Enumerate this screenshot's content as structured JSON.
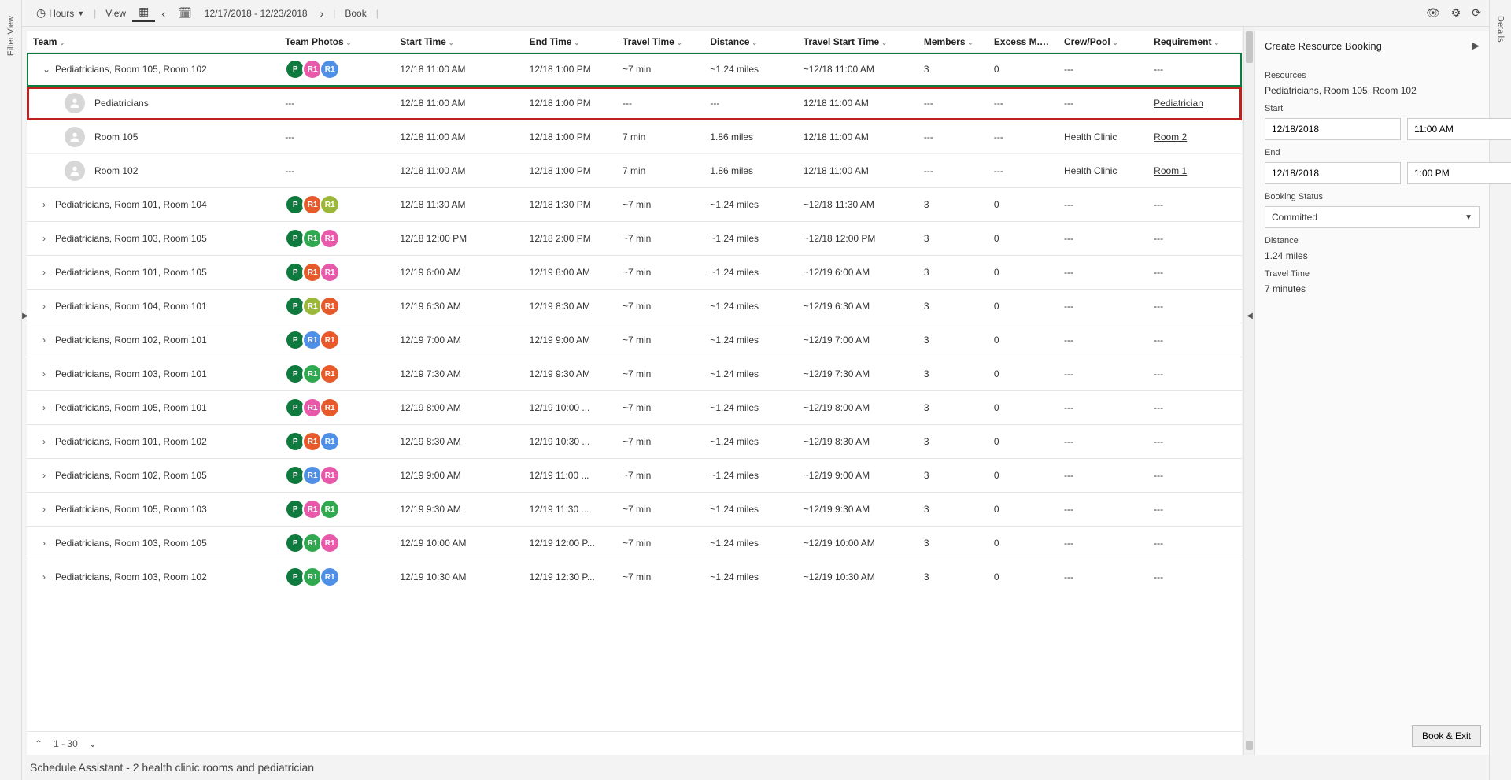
{
  "leftTab": {
    "label": "Filter View"
  },
  "rightTab": {
    "label": "Details"
  },
  "toolbar": {
    "hours": "Hours",
    "view": "View",
    "dateRange": "12/17/2018 - 12/23/2018",
    "book": "Book"
  },
  "columns": {
    "team": "Team",
    "photos": "Team Photos",
    "start": "Start Time",
    "end": "End Time",
    "travel": "Travel Time",
    "dist": "Distance",
    "tstart": "Travel Start Time",
    "members": "Members",
    "excess": "Excess M...",
    "crew": "Crew/Pool",
    "req": "Requirement"
  },
  "colors": {
    "pGreen": "#0f7a3d",
    "orange": "#e65a2c",
    "pink": "#e85aa9",
    "blue": "#4f8fe6",
    "olive": "#9bb83a",
    "green": "#2fa84f",
    "dgreen": "#1f8a3a"
  },
  "rows": [
    {
      "type": "parent",
      "expanded": true,
      "first": true,
      "team": "Pediatricians, Room 105, Room 102",
      "photos": [
        [
          "P",
          "pGreen"
        ],
        [
          "R1",
          "pink"
        ],
        [
          "R1",
          "blue"
        ]
      ],
      "start": "12/18 11:00 AM",
      "end": "12/18 1:00 PM",
      "travel": "~7 min",
      "dist": "~1.24 miles",
      "tstart": "~12/18 11:00 AM",
      "members": "3",
      "excess": "0",
      "crew": "---",
      "req": "---"
    },
    {
      "type": "child",
      "selected": true,
      "team": "Pediatricians",
      "photos": "---",
      "start": "12/18 11:00 AM",
      "end": "12/18 1:00 PM",
      "travel": "---",
      "dist": "---",
      "tstart": "12/18 11:00 AM",
      "members": "---",
      "excess": "---",
      "crew": "---",
      "req": "Pediatrician",
      "reqLink": true
    },
    {
      "type": "child",
      "team": "Room 105",
      "photos": "---",
      "start": "12/18 11:00 AM",
      "end": "12/18 1:00 PM",
      "travel": "7 min",
      "dist": "1.86 miles",
      "tstart": "12/18 11:00 AM",
      "members": "---",
      "excess": "---",
      "crew": "Health Clinic",
      "req": "Room 2",
      "reqLink": true
    },
    {
      "type": "child",
      "team": "Room 102",
      "photos": "---",
      "start": "12/18 11:00 AM",
      "end": "12/18 1:00 PM",
      "travel": "7 min",
      "dist": "1.86 miles",
      "tstart": "12/18 11:00 AM",
      "members": "---",
      "excess": "---",
      "crew": "Health Clinic",
      "req": "Room 1",
      "reqLink": true
    },
    {
      "type": "parent",
      "team": "Pediatricians, Room 101, Room 104",
      "photos": [
        [
          "P",
          "pGreen"
        ],
        [
          "R1",
          "orange"
        ],
        [
          "R1",
          "olive"
        ]
      ],
      "start": "12/18 11:30 AM",
      "end": "12/18 1:30 PM",
      "travel": "~7 min",
      "dist": "~1.24 miles",
      "tstart": "~12/18 11:30 AM",
      "members": "3",
      "excess": "0",
      "crew": "---",
      "req": "---"
    },
    {
      "type": "parent",
      "team": "Pediatricians, Room 103, Room 105",
      "photos": [
        [
          "P",
          "pGreen"
        ],
        [
          "R1",
          "green"
        ],
        [
          "R1",
          "pink"
        ]
      ],
      "start": "12/18 12:00 PM",
      "end": "12/18 2:00 PM",
      "travel": "~7 min",
      "dist": "~1.24 miles",
      "tstart": "~12/18 12:00 PM",
      "members": "3",
      "excess": "0",
      "crew": "---",
      "req": "---"
    },
    {
      "type": "parent",
      "team": "Pediatricians, Room 101, Room 105",
      "photos": [
        [
          "P",
          "pGreen"
        ],
        [
          "R1",
          "orange"
        ],
        [
          "R1",
          "pink"
        ]
      ],
      "start": "12/19 6:00 AM",
      "end": "12/19 8:00 AM",
      "travel": "~7 min",
      "dist": "~1.24 miles",
      "tstart": "~12/19 6:00 AM",
      "members": "3",
      "excess": "0",
      "crew": "---",
      "req": "---"
    },
    {
      "type": "parent",
      "team": "Pediatricians, Room 104, Room 101",
      "photos": [
        [
          "P",
          "pGreen"
        ],
        [
          "R1",
          "olive"
        ],
        [
          "R1",
          "orange"
        ]
      ],
      "start": "12/19 6:30 AM",
      "end": "12/19 8:30 AM",
      "travel": "~7 min",
      "dist": "~1.24 miles",
      "tstart": "~12/19 6:30 AM",
      "members": "3",
      "excess": "0",
      "crew": "---",
      "req": "---"
    },
    {
      "type": "parent",
      "team": "Pediatricians, Room 102, Room 101",
      "photos": [
        [
          "P",
          "pGreen"
        ],
        [
          "R1",
          "blue"
        ],
        [
          "R1",
          "orange"
        ]
      ],
      "start": "12/19 7:00 AM",
      "end": "12/19 9:00 AM",
      "travel": "~7 min",
      "dist": "~1.24 miles",
      "tstart": "~12/19 7:00 AM",
      "members": "3",
      "excess": "0",
      "crew": "---",
      "req": "---"
    },
    {
      "type": "parent",
      "team": "Pediatricians, Room 103, Room 101",
      "photos": [
        [
          "P",
          "pGreen"
        ],
        [
          "R1",
          "green"
        ],
        [
          "R1",
          "orange"
        ]
      ],
      "start": "12/19 7:30 AM",
      "end": "12/19 9:30 AM",
      "travel": "~7 min",
      "dist": "~1.24 miles",
      "tstart": "~12/19 7:30 AM",
      "members": "3",
      "excess": "0",
      "crew": "---",
      "req": "---"
    },
    {
      "type": "parent",
      "team": "Pediatricians, Room 105, Room 101",
      "photos": [
        [
          "P",
          "pGreen"
        ],
        [
          "R1",
          "pink"
        ],
        [
          "R1",
          "orange"
        ]
      ],
      "start": "12/19 8:00 AM",
      "end": "12/19 10:00 ...",
      "travel": "~7 min",
      "dist": "~1.24 miles",
      "tstart": "~12/19 8:00 AM",
      "members": "3",
      "excess": "0",
      "crew": "---",
      "req": "---"
    },
    {
      "type": "parent",
      "team": "Pediatricians, Room 101, Room 102",
      "photos": [
        [
          "P",
          "pGreen"
        ],
        [
          "R1",
          "orange"
        ],
        [
          "R1",
          "blue"
        ]
      ],
      "start": "12/19 8:30 AM",
      "end": "12/19 10:30 ...",
      "travel": "~7 min",
      "dist": "~1.24 miles",
      "tstart": "~12/19 8:30 AM",
      "members": "3",
      "excess": "0",
      "crew": "---",
      "req": "---"
    },
    {
      "type": "parent",
      "team": "Pediatricians, Room 102, Room 105",
      "photos": [
        [
          "P",
          "pGreen"
        ],
        [
          "R1",
          "blue"
        ],
        [
          "R1",
          "pink"
        ]
      ],
      "start": "12/19 9:00 AM",
      "end": "12/19 11:00 ...",
      "travel": "~7 min",
      "dist": "~1.24 miles",
      "tstart": "~12/19 9:00 AM",
      "members": "3",
      "excess": "0",
      "crew": "---",
      "req": "---"
    },
    {
      "type": "parent",
      "team": "Pediatricians, Room 105, Room 103",
      "photos": [
        [
          "P",
          "pGreen"
        ],
        [
          "R1",
          "pink"
        ],
        [
          "R1",
          "green"
        ]
      ],
      "start": "12/19 9:30 AM",
      "end": "12/19 11:30 ...",
      "travel": "~7 min",
      "dist": "~1.24 miles",
      "tstart": "~12/19 9:30 AM",
      "members": "3",
      "excess": "0",
      "crew": "---",
      "req": "---"
    },
    {
      "type": "parent",
      "team": "Pediatricians, Room 103, Room 105",
      "photos": [
        [
          "P",
          "pGreen"
        ],
        [
          "R1",
          "green"
        ],
        [
          "R1",
          "pink"
        ]
      ],
      "start": "12/19 10:00 AM",
      "end": "12/19 12:00 P...",
      "travel": "~7 min",
      "dist": "~1.24 miles",
      "tstart": "~12/19 10:00 AM",
      "members": "3",
      "excess": "0",
      "crew": "---",
      "req": "---"
    },
    {
      "type": "parent",
      "team": "Pediatricians, Room 103, Room 102",
      "photos": [
        [
          "P",
          "pGreen"
        ],
        [
          "R1",
          "green"
        ],
        [
          "R1",
          "blue"
        ]
      ],
      "start": "12/19 10:30 AM",
      "end": "12/19 12:30 P...",
      "travel": "~7 min",
      "dist": "~1.24 miles",
      "tstart": "~12/19 10:30 AM",
      "members": "3",
      "excess": "0",
      "crew": "---",
      "req": "---"
    }
  ],
  "pager": {
    "range": "1 - 30"
  },
  "caption": "Schedule Assistant - 2 health clinic rooms and pediatrician",
  "panel": {
    "title": "Create Resource Booking",
    "resourcesLabel": "Resources",
    "resourcesVal": "Pediatricians, Room 105, Room 102",
    "startLabel": "Start",
    "startDate": "12/18/2018",
    "startTime": "11:00 AM",
    "endLabel": "End",
    "endDate": "12/18/2018",
    "endTime": "1:00 PM",
    "statusLabel": "Booking Status",
    "statusVal": "Committed",
    "distLabel": "Distance",
    "distVal": "1.24 miles",
    "travelLabel": "Travel Time",
    "travelVal": "7 minutes",
    "bookExit": "Book & Exit"
  }
}
